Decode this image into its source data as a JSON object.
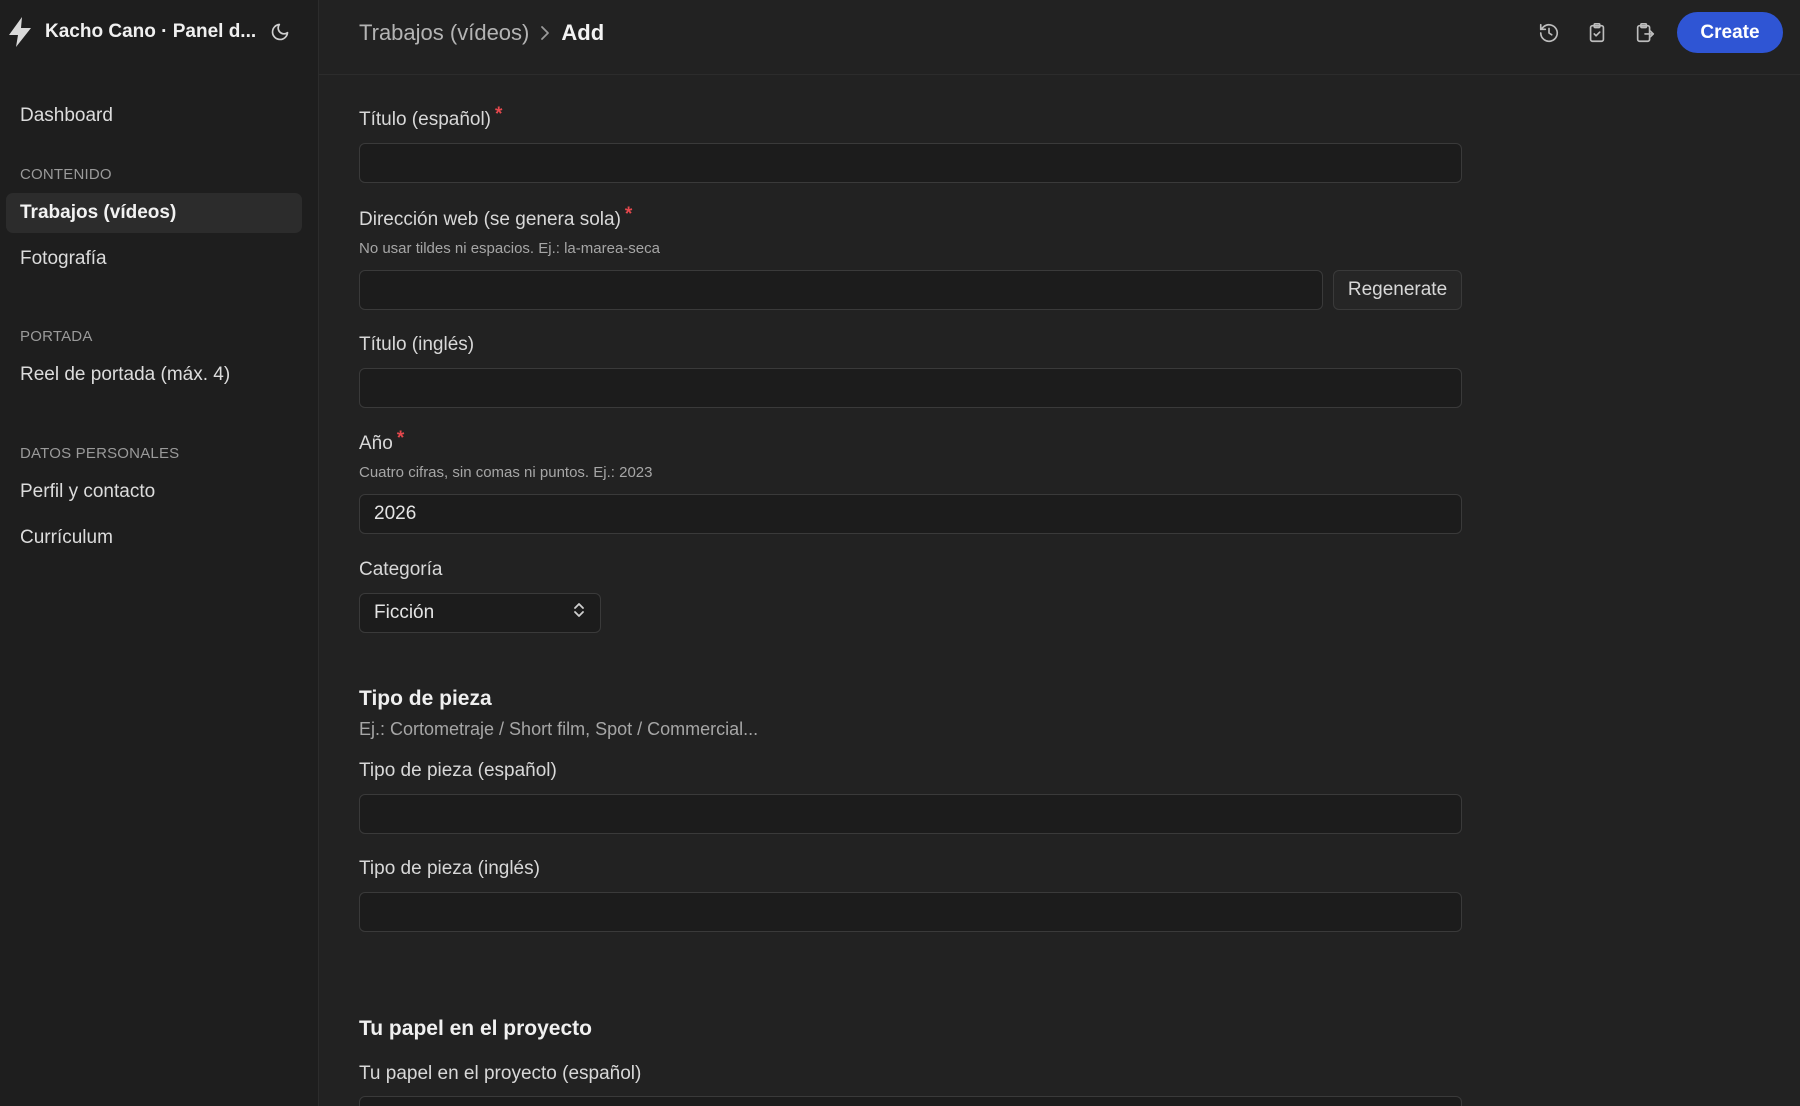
{
  "app": {
    "title": "Kacho Cano · Panel d...",
    "logo_icon": "bolt-icon",
    "theme_icon": "moon-icon"
  },
  "sidebar": {
    "dashboard": "Dashboard",
    "sections": [
      {
        "title": "CONTENIDO",
        "items": [
          "Trabajos (vídeos)",
          "Fotografía"
        ]
      },
      {
        "title": "PORTADA",
        "items": [
          "Reel de portada (máx. 4)"
        ]
      },
      {
        "title": "DATOS PERSONALES",
        "items": [
          "Perfil y contacto",
          "Currículum"
        ]
      }
    ],
    "active_item": "Trabajos (vídeos)"
  },
  "header": {
    "breadcrumb_parent": "Trabajos (vídeos)",
    "breadcrumb_current": "Add",
    "icons": [
      "history-icon",
      "paste-icon",
      "export-icon"
    ],
    "create_label": "Create",
    "accent_color": "#2f55d4"
  },
  "form": {
    "titulo_es": {
      "label": "Título (español)",
      "required": "*",
      "value": ""
    },
    "slug": {
      "label": "Dirección web (se genera sola)",
      "required": "*",
      "hint": "No usar tildes ni espacios. Ej.: la-marea-seca",
      "value": "",
      "regenerate_label": "Regenerate"
    },
    "titulo_en": {
      "label": "Título (inglés)",
      "value": ""
    },
    "anio": {
      "label": "Año",
      "required": "*",
      "hint": "Cuatro cifras, sin comas ni puntos. Ej.: 2023",
      "value": "2026"
    },
    "categoria": {
      "label": "Categoría",
      "value": "Ficción"
    },
    "tipo_pieza": {
      "title": "Tipo de pieza",
      "subtitle": "Ej.: Cortometraje / Short film, Spot / Commercial...",
      "es_label": "Tipo de pieza (español)",
      "es_value": "",
      "en_label": "Tipo de pieza (inglés)",
      "en_value": ""
    },
    "papel": {
      "title": "Tu papel en el proyecto",
      "es_label": "Tu papel en el proyecto (español)",
      "es_value": ""
    }
  }
}
